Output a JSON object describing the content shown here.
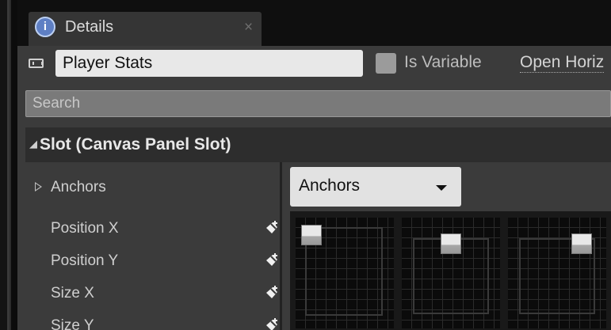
{
  "details_tab": {
    "icon": "details-info-icon",
    "label": "Details",
    "close": "×"
  },
  "name_bar": {
    "icon": "widget-icon",
    "name_value": "Player Stats",
    "is_variable_label": "Is Variable",
    "is_variable_checked": false,
    "open_link": "Open Horiz"
  },
  "search": {
    "placeholder": "Search"
  },
  "section": {
    "title": "Slot (Canvas Panel Slot)",
    "expanded": true
  },
  "properties": [
    {
      "label": "Anchors",
      "expandable": true
    },
    {
      "label": "Position X",
      "icon": "pin-icon"
    },
    {
      "label": "Position Y",
      "icon": "pin-icon"
    },
    {
      "label": "Size X",
      "icon": "pin-icon"
    },
    {
      "label": "Size Y",
      "icon": "pin-icon"
    }
  ],
  "anchors_dropdown": {
    "label": "Anchors"
  },
  "anchor_presets": [
    {
      "name": "top-left"
    },
    {
      "name": "top-center"
    },
    {
      "name": "top-right"
    }
  ],
  "colors": {
    "panel_bg": "#3b3b3b",
    "header_bg": "#2d2d2d",
    "tab_bg": "#353535",
    "input_bg": "#e8e8e8",
    "info_icon_blue": "#5e7fc4"
  }
}
